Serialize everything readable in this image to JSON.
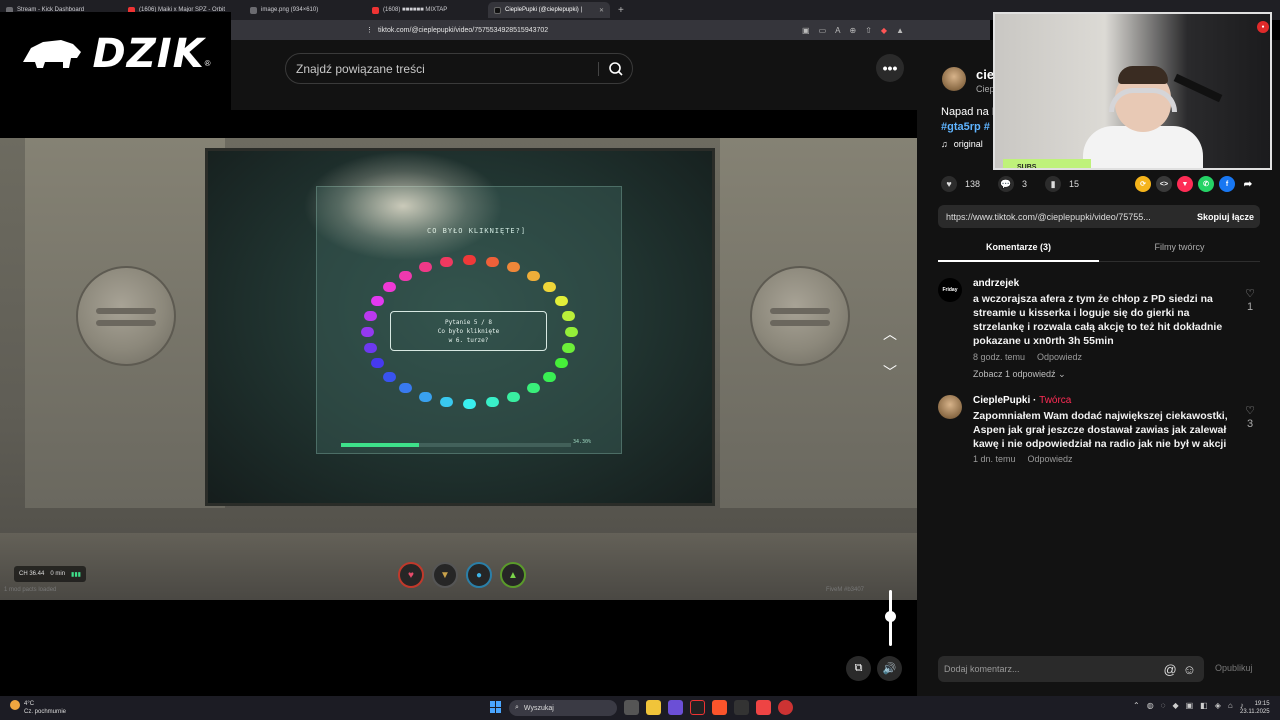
{
  "browser": {
    "tabs": [
      {
        "label": "Stream - Kick Dashboard",
        "active": false
      },
      {
        "label": "(1606) Maiki x Major SPZ - Orbit",
        "active": false
      },
      {
        "label": "image.png (934×610)",
        "active": false
      },
      {
        "label": "(1608) ■■■■■■ MIXTAP",
        "active": false
      },
      {
        "label": "CieplePupki (@cieplepupki) |",
        "active": true
      }
    ],
    "url": "tiktok.com/@cieplepupki/video/7575534928515943702"
  },
  "overlay": {
    "logo_text": "DZIK",
    "logo_mark": "®",
    "webcam_tag": "SUBS"
  },
  "search": {
    "placeholder": "Znajdź powiązane treści"
  },
  "game": {
    "title": "CO BYŁO KLIKNIĘTE?]",
    "question_line1": "Pytanie 5 / 8",
    "question_line2": "Co było kliknięte",
    "question_line3": "w 6. turze?",
    "progress": 0.34,
    "progress_label": "34.30%",
    "hud_chip": "CH 36.44",
    "hud_chip2": "0 min",
    "status_left": "1 mod pacts loaded",
    "status_right": "FiveM #b3407"
  },
  "author": {
    "name": "ciep",
    "sub": "Ciep"
  },
  "description": {
    "text": "Napad na I",
    "tags": "#gta5rp #",
    "sound": "original"
  },
  "stats": {
    "likes": "138",
    "comments": "3",
    "saves": "15"
  },
  "link": {
    "url": "https://www.tiktok.com/@cieplepupki/video/75755...",
    "copy_label": "Skopiuj łącze"
  },
  "tabs": {
    "comments": "Komentarze (3)",
    "creator_videos": "Filmy twórcy"
  },
  "comments": [
    {
      "user": "andrzejek",
      "avatar_text": "Friday",
      "text": "a wczorajsza afera z tym że chłop z PD siedzi na streamie u kisserka i loguje się do gierki na strzelankę i rozwala całą akcję to też hit dokładnie pokazane u xn0rth 3h 55min",
      "time": "8 godz. temu",
      "reply": "Odpowiedz",
      "more": "Zobacz 1 odpowiedź",
      "likes": "1"
    },
    {
      "user": "CieplePupki",
      "creator_label": "Twórca",
      "text": "Zapomniałem Wam dodać największej ciekawostki, Aspen jak grał jeszcze dostawał zawias jak zalewał kawę i nie odpowiedział na radio jak nie był w akcji",
      "time": "1 dn. temu",
      "reply": "Odpowiedz",
      "likes": "3"
    }
  ],
  "composer": {
    "placeholder": "Dodaj komentarz...",
    "publish": "Opublikuj"
  },
  "taskbar": {
    "temp": "4°C",
    "weather": "Cz. pochmurnie",
    "search": "Wyszukaj",
    "time": "19:15",
    "date": "23.11.2025"
  }
}
